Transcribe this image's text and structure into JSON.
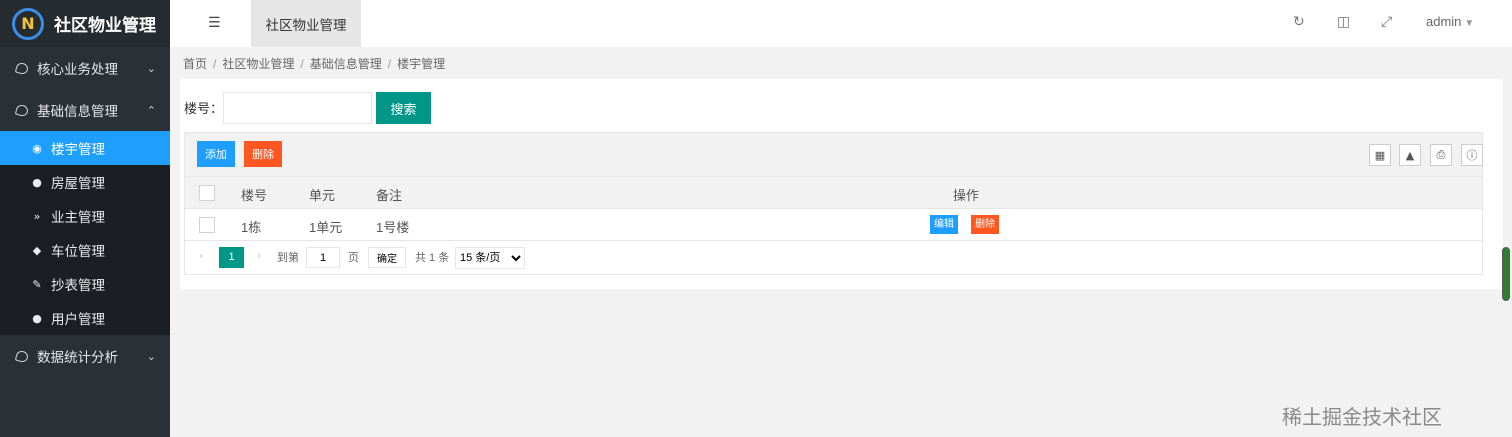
{
  "app": {
    "title": "社区物业管理"
  },
  "sidebar": {
    "groups": [
      {
        "label": "核心业务处理",
        "chevron": "down"
      },
      {
        "label": "基础信息管理",
        "chevron": "up"
      },
      {
        "label": "数据统计分析",
        "chevron": "down"
      }
    ],
    "items": [
      {
        "label": "楼宇管理",
        "icon": "target-icon",
        "active": true
      },
      {
        "label": "房屋管理",
        "icon": "home-icon"
      },
      {
        "label": "业主管理",
        "icon": "double-chevron-icon"
      },
      {
        "label": "车位管理",
        "icon": "car-icon"
      },
      {
        "label": "抄表管理",
        "icon": "edit-icon"
      },
      {
        "label": "用户管理",
        "icon": "user-icon"
      }
    ],
    "colors": {
      "bg": "#2b3036",
      "active": "#1e9fff"
    }
  },
  "header": {
    "tab": "社区物业管理",
    "user": "admin",
    "icons": [
      "menu-icon",
      "refresh-icon",
      "trash-icon",
      "fullscreen-icon"
    ]
  },
  "breadcrumb": [
    "首页",
    "社区物业管理",
    "基础信息管理",
    "楼宇管理"
  ],
  "search": {
    "label": "楼号：",
    "value": "",
    "placeholder": "",
    "button": "搜索"
  },
  "toolbar": {
    "add": "添加",
    "delete": "删除",
    "icons": [
      "columns-icon",
      "export-icon",
      "print-icon",
      "info-icon"
    ]
  },
  "table": {
    "columns": [
      "楼号",
      "单元",
      "备注",
      "操作"
    ],
    "rows": [
      {
        "building": "1栋",
        "unit": "1单元",
        "note": "1号楼",
        "edit": "编辑",
        "delete": "删除"
      }
    ]
  },
  "pager": {
    "current": "1",
    "goto_label": "到第",
    "goto_value": "1",
    "page_label": "页",
    "confirm": "确定",
    "total": "共 1 条",
    "per_page": "15 条/页"
  },
  "watermark": {
    "text": "稀土掘金技术社区",
    "url": "https://blog.csdn.net/..."
  }
}
